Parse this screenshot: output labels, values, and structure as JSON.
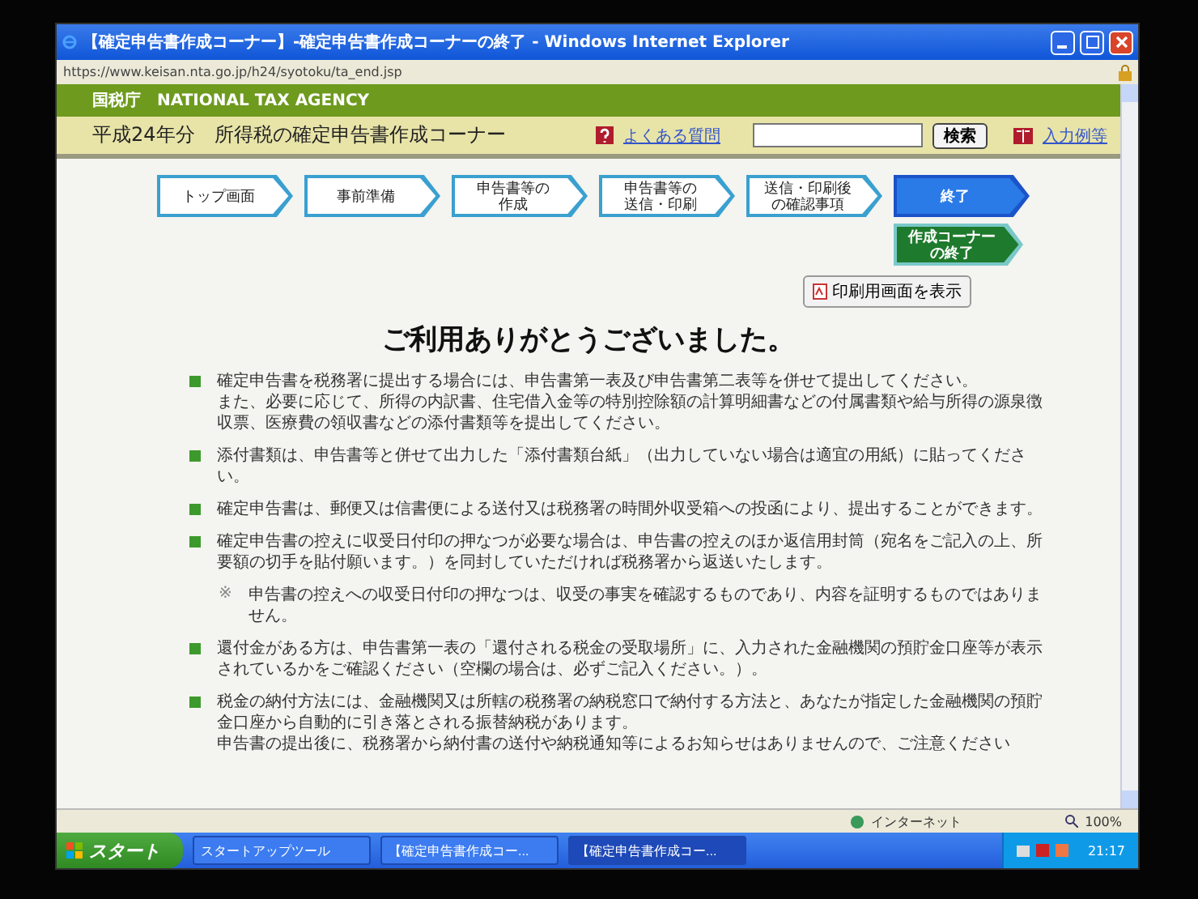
{
  "window": {
    "title": "【確定申告書作成コーナー】-確定申告書作成コーナーの終了 - Windows Internet Explorer"
  },
  "address_bar": {
    "url": "https://www.keisan.nta.go.jp/h24/syotoku/ta_end.jsp"
  },
  "header": {
    "agency": "国税庁　NATIONAL TAX AGENCY",
    "title": "平成24年分　所得税の確定申告書作成コーナー",
    "faq_link": "よくある質問",
    "search_button": "検索",
    "example_link": "入力例等"
  },
  "steps": [
    {
      "lines": [
        "トップ画面"
      ],
      "selected": false
    },
    {
      "lines": [
        "事前準備"
      ],
      "selected": false
    },
    {
      "lines": [
        "申告書等の",
        "作成"
      ],
      "selected": false
    },
    {
      "lines": [
        "申告書等の",
        "送信・印刷"
      ],
      "selected": false
    },
    {
      "lines": [
        "送信・印刷後",
        "の確認事項"
      ],
      "selected": false
    },
    {
      "lines": [
        "終了"
      ],
      "selected": true
    }
  ],
  "substep": {
    "lines": [
      "作成コーナー",
      "の終了"
    ],
    "selected": true
  },
  "print_button": "印刷用画面を表示",
  "heading": "ご利用ありがとうございました。",
  "notices": [
    {
      "kind": "bullet",
      "text": "確定申告書を税務署に提出する場合には、申告書第一表及び申告書第二表等を併せて提出してください。",
      "more": "また、必要に応じて、所得の内訳書、住宅借入金等の特別控除額の計算明細書などの付属書類や給与所得の源泉徴収票、医療費の領収書などの添付書類等を提出してください。"
    },
    {
      "kind": "bullet",
      "text": "添付書類は、申告書等と併せて出力した「添付書類台紙」（出力していない場合は適宜の用紙）に貼ってください。"
    },
    {
      "kind": "bullet",
      "text": "確定申告書は、郵便又は信書便による送付又は税務署の時間外収受箱への投函により、提出することができます。"
    },
    {
      "kind": "bullet",
      "text": "確定申告書の控えに収受日付印の押なつが必要な場合は、申告書の控えのほか返信用封筒（宛名をご記入の上、所要額の切手を貼付願います。）を同封していただければ税務署から返送いたします。"
    },
    {
      "kind": "note",
      "mark": "※",
      "text": "申告書の控えへの収受日付印の押なつは、収受の事実を確認するものであり、内容を証明するものではありません。"
    },
    {
      "kind": "bullet",
      "text": "還付金がある方は、申告書第一表の「還付される税金の受取場所」に、入力された金融機関の預貯金口座等が表示されているかをご確認ください（空欄の場合は、必ずご記入ください。）。"
    },
    {
      "kind": "bullet",
      "text": "税金の納付方法には、金融機関又は所轄の税務署の納税窓口で納付する方法と、あなたが指定した金融機関の預貯金口座から自動的に引き落とされる振替納税があります。",
      "more": "申告書の提出後に、税務署から納付書の送付や納税通知等によるお知らせはありませんので、ご注意ください"
    }
  ],
  "status_bar": {
    "zone": "インターネット",
    "zoom": "100%"
  },
  "taskbar": {
    "start": "スタート",
    "items": [
      {
        "label": "スタートアップツール",
        "selected": false
      },
      {
        "label": "【確定申告書作成コー...",
        "selected": false
      },
      {
        "label": "【確定申告書作成コー...",
        "selected": true
      }
    ],
    "clock": "21:17"
  }
}
